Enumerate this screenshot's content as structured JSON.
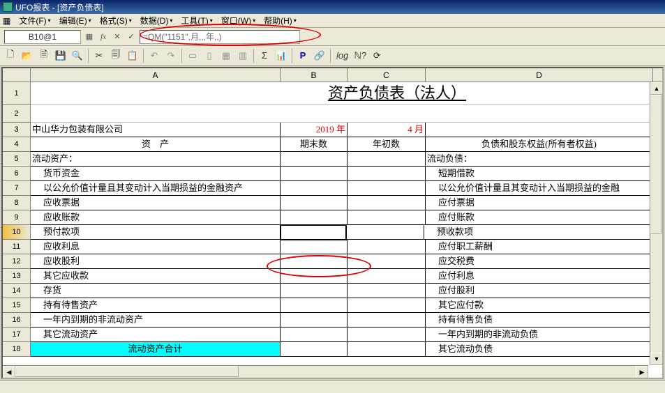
{
  "title": "UFO报表 - [资产负债表]",
  "menus": [
    "文件(F)",
    "编辑(E)",
    "格式(S)",
    "数据(D)",
    "工具(T)",
    "窗口(W)",
    "帮助(H)"
  ],
  "cell_ref": "B10@1",
  "formula": "=QM(\"1151\",月,,,年,,)",
  "columns": [
    "A",
    "B",
    "C",
    "D"
  ],
  "sheet_title": "资产负债表（法人）",
  "company": "中山华力包装有限公司",
  "year_label": "2019 年",
  "month_label": "4 月",
  "headers": {
    "a": "资　产",
    "b": "期末数",
    "c": "年初数",
    "d": "负债和股东权益(所有者权益)"
  },
  "rows": [
    {
      "n": "5",
      "a": "流动资产：",
      "d": "流动负债："
    },
    {
      "n": "6",
      "a": "货币资金",
      "d": "短期借款"
    },
    {
      "n": "7",
      "a": "以公允价值计量且其变动计入当期损益的金融资产",
      "d": "以公允价值计量且其变动计入当期损益的金融"
    },
    {
      "n": "8",
      "a": "应收票据",
      "d": "应付票据"
    },
    {
      "n": "9",
      "a": "应收账款",
      "d": "应付账款"
    },
    {
      "n": "10",
      "a": "预付款项",
      "d": "预收款项",
      "sel": true
    },
    {
      "n": "11",
      "a": "应收利息",
      "d": "应付职工薪酬"
    },
    {
      "n": "12",
      "a": "应收股利",
      "d": "应交税费"
    },
    {
      "n": "13",
      "a": "其它应收款",
      "d": "应付利息"
    },
    {
      "n": "14",
      "a": "存货",
      "d": "应付股利"
    },
    {
      "n": "15",
      "a": "持有待售资产",
      "d": "其它应付款"
    },
    {
      "n": "16",
      "a": "一年内到期的非流动资产",
      "d": "持有待售负债"
    },
    {
      "n": "17",
      "a": "其它流动资产",
      "d": "一年内到期的非流动负债"
    },
    {
      "n": "18",
      "a": "流动资产合计",
      "d": "其它流动负债",
      "cyan": true
    }
  ],
  "chart_data": {
    "type": "table",
    "title": "资产负债表（法人）",
    "company": "中山华力包装有限公司",
    "period": {
      "year": 2019,
      "month": 4
    },
    "columns": [
      "资产",
      "期末数",
      "年初数",
      "负债和股东权益(所有者权益)"
    ],
    "asset_rows": [
      "流动资产：",
      "货币资金",
      "以公允价值计量且其变动计入当期损益的金融资产",
      "应收票据",
      "应收账款",
      "预付款项",
      "应收利息",
      "应收股利",
      "其它应收款",
      "存货",
      "持有待售资产",
      "一年内到期的非流动资产",
      "其它流动资产",
      "流动资产合计"
    ],
    "liability_rows": [
      "流动负债：",
      "短期借款",
      "以公允价值计量且其变动计入当期损益的金融",
      "应付票据",
      "应付账款",
      "预收款项",
      "应付职工薪酬",
      "应交税费",
      "应付利息",
      "应付股利",
      "其它应付款",
      "持有待售负债",
      "一年内到期的非流动负债",
      "其它流动负债"
    ]
  }
}
